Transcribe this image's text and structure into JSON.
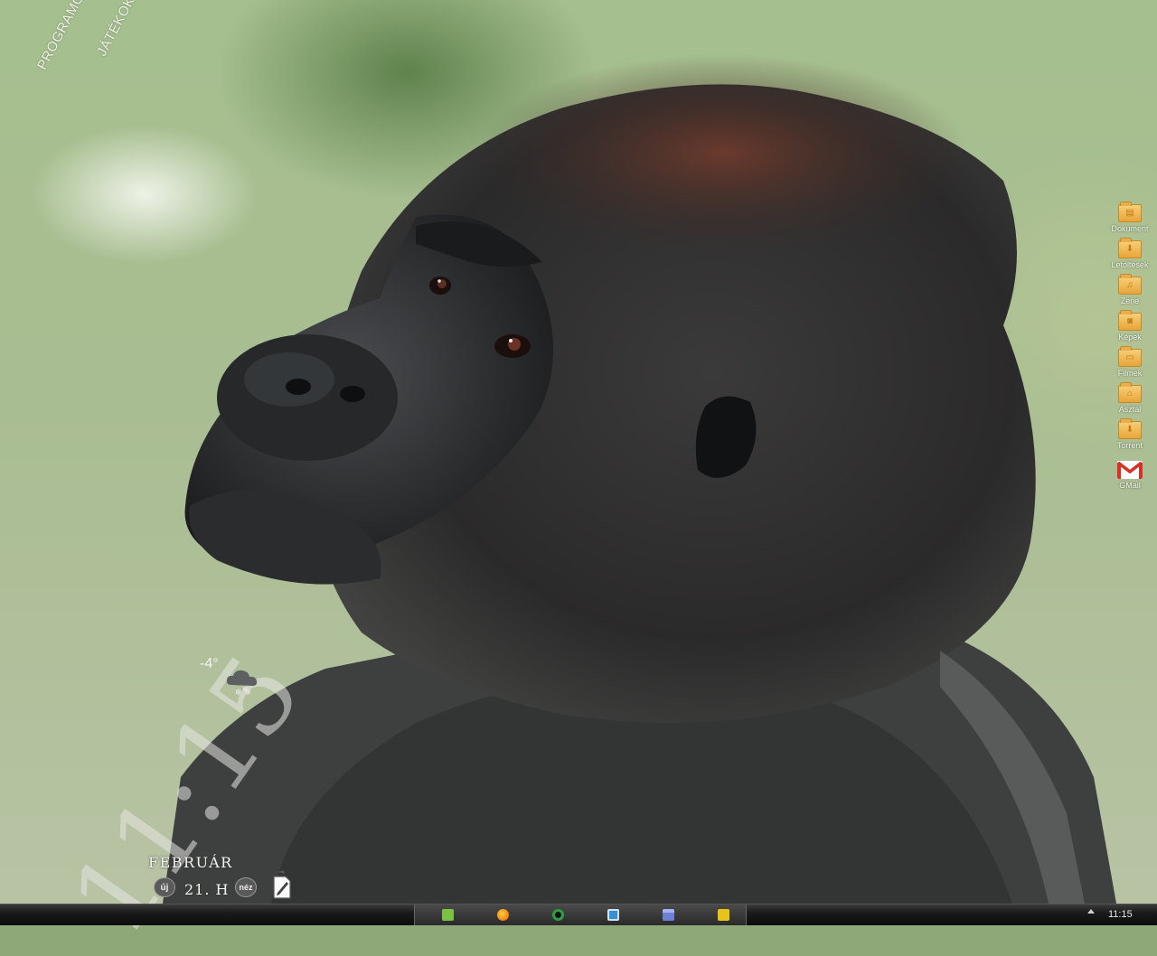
{
  "desktop": {
    "launchers": {
      "programs": "PROGRAMOK",
      "games": "JÁTÉKOK"
    },
    "folders": [
      {
        "label": "Dokument",
        "icon": "document-folder-icon",
        "glyph": "▤"
      },
      {
        "label": "Letöltések",
        "icon": "downloads-folder-icon",
        "glyph": "⬇"
      },
      {
        "label": "Zene",
        "icon": "music-folder-icon",
        "glyph": "♫"
      },
      {
        "label": "Képek",
        "icon": "pictures-folder-icon",
        "glyph": "◙"
      },
      {
        "label": "Filmek",
        "icon": "movies-folder-icon",
        "glyph": "▭"
      },
      {
        "label": "Asztal",
        "icon": "desktop-folder-icon",
        "glyph": "⌂"
      },
      {
        "label": "Torrent",
        "icon": "torrent-folder-icon",
        "glyph": "⬇"
      }
    ],
    "gmail": {
      "label": "GMail",
      "icon": "gmail-icon",
      "color": "#d93025"
    }
  },
  "widget": {
    "time": "11:15",
    "temperature": "-4°",
    "weather_icon": "cloud-snow-icon",
    "month": "FEBRUÁR",
    "day": "21. H",
    "new_label": "új",
    "view_label": "néz",
    "note_icon": "note-edit-icon"
  },
  "taskbar": {
    "tasks": [
      {
        "name": "task-app-1",
        "icon": "android-icon",
        "color": "#7cc142"
      },
      {
        "name": "task-firefox",
        "icon": "firefox-icon",
        "color": "#e66000"
      },
      {
        "name": "task-app-3",
        "icon": "green-circle-icon",
        "color": "#2ea043"
      },
      {
        "name": "task-app-4",
        "icon": "floppy-icon",
        "color": "#3a8fd6"
      },
      {
        "name": "task-app-5",
        "icon": "window-icon",
        "color": "#6f7fd6"
      },
      {
        "name": "task-app-6",
        "icon": "pencil-icon",
        "color": "#e8c417"
      }
    ],
    "clock": "11:15"
  }
}
